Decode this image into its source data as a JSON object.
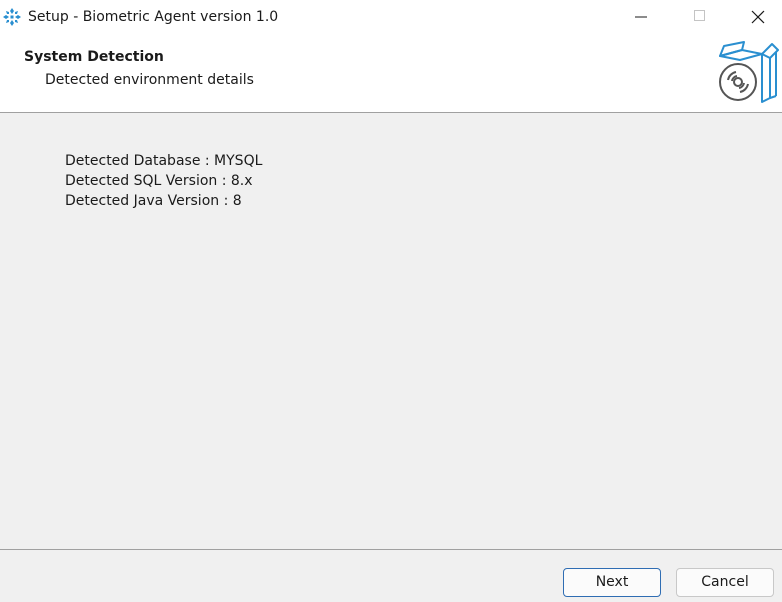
{
  "window": {
    "title": "Setup - Biometric Agent version 1.0",
    "app_icon": "setup-snowflake-icon",
    "controls": [
      "minimize-icon",
      "maximize-icon",
      "close-icon"
    ]
  },
  "header": {
    "title": "System Detection",
    "subtitle": "Detected environment details",
    "image": "software-box-icon"
  },
  "details": {
    "database": "Detected Database : MYSQL",
    "sql_version": "Detected SQL Version : 8.x",
    "java_version": "Detected Java Version : 8"
  },
  "buttons": {
    "next": "Next",
    "cancel": "Cancel"
  },
  "colors": {
    "accent": "#2f6db3",
    "icon_blue": "#2a8fd0",
    "background": "#f0f0f0"
  }
}
